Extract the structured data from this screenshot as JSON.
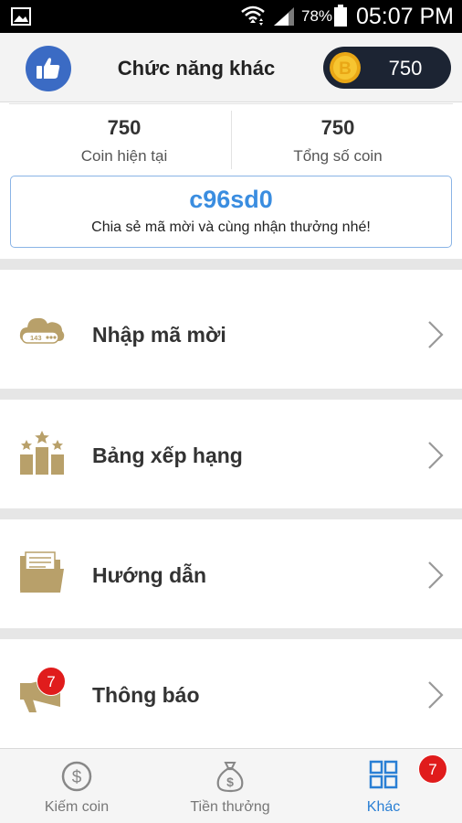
{
  "status_bar": {
    "battery_percent": "78%",
    "time": "05:07 PM",
    "icons": [
      "gallery-icon",
      "wifi-icon",
      "signal-icon",
      "battery-icon"
    ]
  },
  "header": {
    "title": "Chức năng khác",
    "coin_balance": "750",
    "icons": [
      "thumbs-up-icon",
      "bitcoin-coin-icon"
    ]
  },
  "stats": {
    "current_coin": {
      "value": "750",
      "label": "Coin hiện tại"
    },
    "total_coin": {
      "value": "750",
      "label": "Tổng số coin"
    }
  },
  "invite": {
    "code": "c96sd0",
    "message": "Chia sẻ mã mời và cùng nhận thưởng nhé!"
  },
  "menu": [
    {
      "label": "Nhập mã mời",
      "icon": "cloud-password-icon"
    },
    {
      "label": "Bảng xếp hạng",
      "icon": "leaderboard-icon"
    },
    {
      "label": "Hướng dẫn",
      "icon": "folder-icon"
    },
    {
      "label": "Thông báo",
      "icon": "megaphone-icon",
      "badge": "7"
    }
  ],
  "bottom_nav": [
    {
      "label": "Kiếm coin",
      "icon": "dollar-circle-icon",
      "active": false
    },
    {
      "label": "Tiền thưởng",
      "icon": "money-bag-icon",
      "active": false
    },
    {
      "label": "Khác",
      "icon": "grid-icon",
      "active": true,
      "badge": "7"
    }
  ],
  "colors": {
    "accent_blue": "#2a7fd4",
    "gold": "#b8a06a",
    "badge_red": "#e01c1c",
    "header_bg": "#f3f3f3",
    "coin_pill_bg": "#1c2433"
  }
}
